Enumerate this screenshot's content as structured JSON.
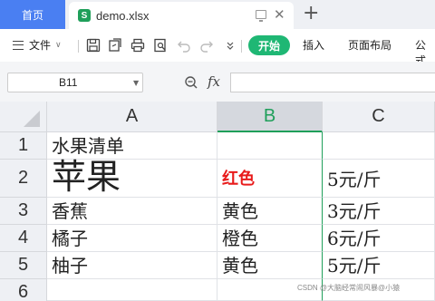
{
  "tabs": {
    "home": "首页",
    "file_name": "demo.xlsx"
  },
  "toolbar": {
    "file_menu": "文件",
    "start": "开始",
    "insert": "插入",
    "page_layout": "页面布局",
    "formula": "公式"
  },
  "formula_bar": {
    "cell_ref": "B11",
    "fx_label": "fx",
    "value": ""
  },
  "columns": [
    "A",
    "B",
    "C"
  ],
  "active_column": "B",
  "rows": [
    "1",
    "2",
    "3",
    "4",
    "5",
    "6"
  ],
  "cells": {
    "A1": "水果清单",
    "A2": "苹果",
    "B2": "红色",
    "C2": "5元/斤",
    "A3": "香蕉",
    "B3": "黄色",
    "C3": "3元/斤",
    "A4": "橘子",
    "B4": "橙色",
    "C4": "6元/斤",
    "A5": "柚子",
    "B5": "黄色",
    "C5": "5元/斤"
  },
  "colors": {
    "accent_blue": "#4a7ff2",
    "start_green": "#1fb774",
    "red_text": "#e81b1b",
    "active_col": "#1f9f5a"
  },
  "watermark": "CSDN @大脑经常闹风暴@小猿"
}
